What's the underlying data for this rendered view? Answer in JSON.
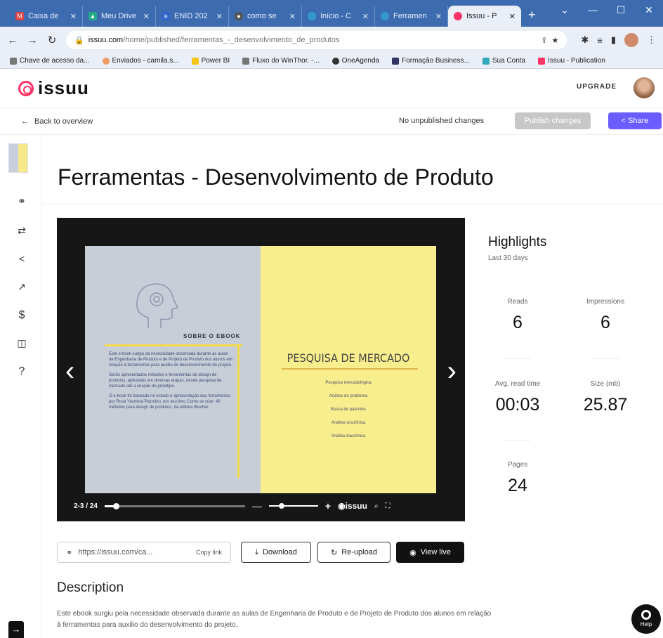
{
  "browser": {
    "tabs": [
      {
        "label": "Caixa de",
        "icon": "gmail-icon",
        "color": "#d44"
      },
      {
        "label": "Meu Drive",
        "icon": "drive-icon",
        "color": "#2a8"
      },
      {
        "label": "ENID 202",
        "icon": "doc-icon",
        "color": "#36c"
      },
      {
        "label": "como se",
        "icon": "chrome-icon",
        "color": "#555"
      },
      {
        "label": "Início - C",
        "icon": "web-icon",
        "color": "#39c"
      },
      {
        "label": "Ferramen",
        "icon": "web-icon",
        "color": "#39c"
      },
      {
        "label": "Issuu - P",
        "icon": "issuu-icon",
        "color": "#f36",
        "active": true
      }
    ],
    "url_host": "issuu.com",
    "url_path": "/home/published/ferramentas_-_desenvolvimento_de_produtos",
    "bookmarks": [
      {
        "label": "Chave de acesso da...",
        "color": "#777"
      },
      {
        "label": "Enviados - camila.s...",
        "color": "#e96"
      },
      {
        "label": "Power BI",
        "color": "#f5c518"
      },
      {
        "label": "Fluxo do WinThor. -...",
        "color": "#777"
      },
      {
        "label": "OneAgenda",
        "color": "#333"
      },
      {
        "label": "Formação Business...",
        "color": "#336"
      },
      {
        "label": "Sua Conta",
        "color": "#3ab"
      },
      {
        "label": "Issuu - Publication",
        "color": "#f36"
      }
    ]
  },
  "header": {
    "logo_text": "issuu",
    "upgrade_label": "UPGRADE"
  },
  "subbar": {
    "back_label": "Back to overview",
    "status": "No unpublished changes",
    "publish_label": "Publish changes",
    "share_label": "Share"
  },
  "page_title": "Ferramentas - Desenvolvimento de Produto",
  "viewer": {
    "left_page": {
      "heading": "SOBRE O EBOOK",
      "paragraphs": [
        "Este e-book surgiu da necessidade observada durante as aulas de Engenharia de Produto e de Projeto de Produto dos alunos em relação à ferramentas para auxilio do desenvolvimento do projeto.",
        "Serão apresentados métodos e ferramentas de design de produtos, aplicáveis em diversas etapas, desde pesquisa de mercado até a criação de protótipo.",
        "O e-book foi baseado no estudo e apresentação das ferramentas por Rosa Yasmina Pazmino, em seu livro Como se criar: 40 métodos para design de produtos, da editora Blucher."
      ]
    },
    "right_page": {
      "heading": "PESQUISA DE MERCADO",
      "items": [
        "Pesquisa mercadológica",
        "Análise do problema",
        "Busca de patentes",
        "Análise sincrônica",
        "Análise diacrônica"
      ]
    },
    "page_indicator": "2-3 / 24",
    "progress": 0.08,
    "brand": "issuu"
  },
  "highlights": {
    "title": "Highlights",
    "period": "Last 30 days",
    "stats": [
      {
        "label": "Reads",
        "value": "6"
      },
      {
        "label": "Impressions",
        "value": "6"
      },
      {
        "label": "Avg. read time",
        "value": "00:03"
      },
      {
        "label": "Size (mb)",
        "value": "25.87"
      },
      {
        "label": "Pages",
        "value": "24"
      }
    ]
  },
  "actions": {
    "link": "https://issuu.com/ca...",
    "copy_label": "Copy link",
    "download_label": "Download",
    "reupload_label": "Re-upload",
    "view_live_label": "View live"
  },
  "description": {
    "title": "Description",
    "text": "Este ebook surgiu pela necessidade observada durante as aulas de Engenharia de Produto e de Projeto de Produto dos alunos em relação à ferramentas para auxilio do desenvolvimento do projeto."
  },
  "help_label": "Help"
}
